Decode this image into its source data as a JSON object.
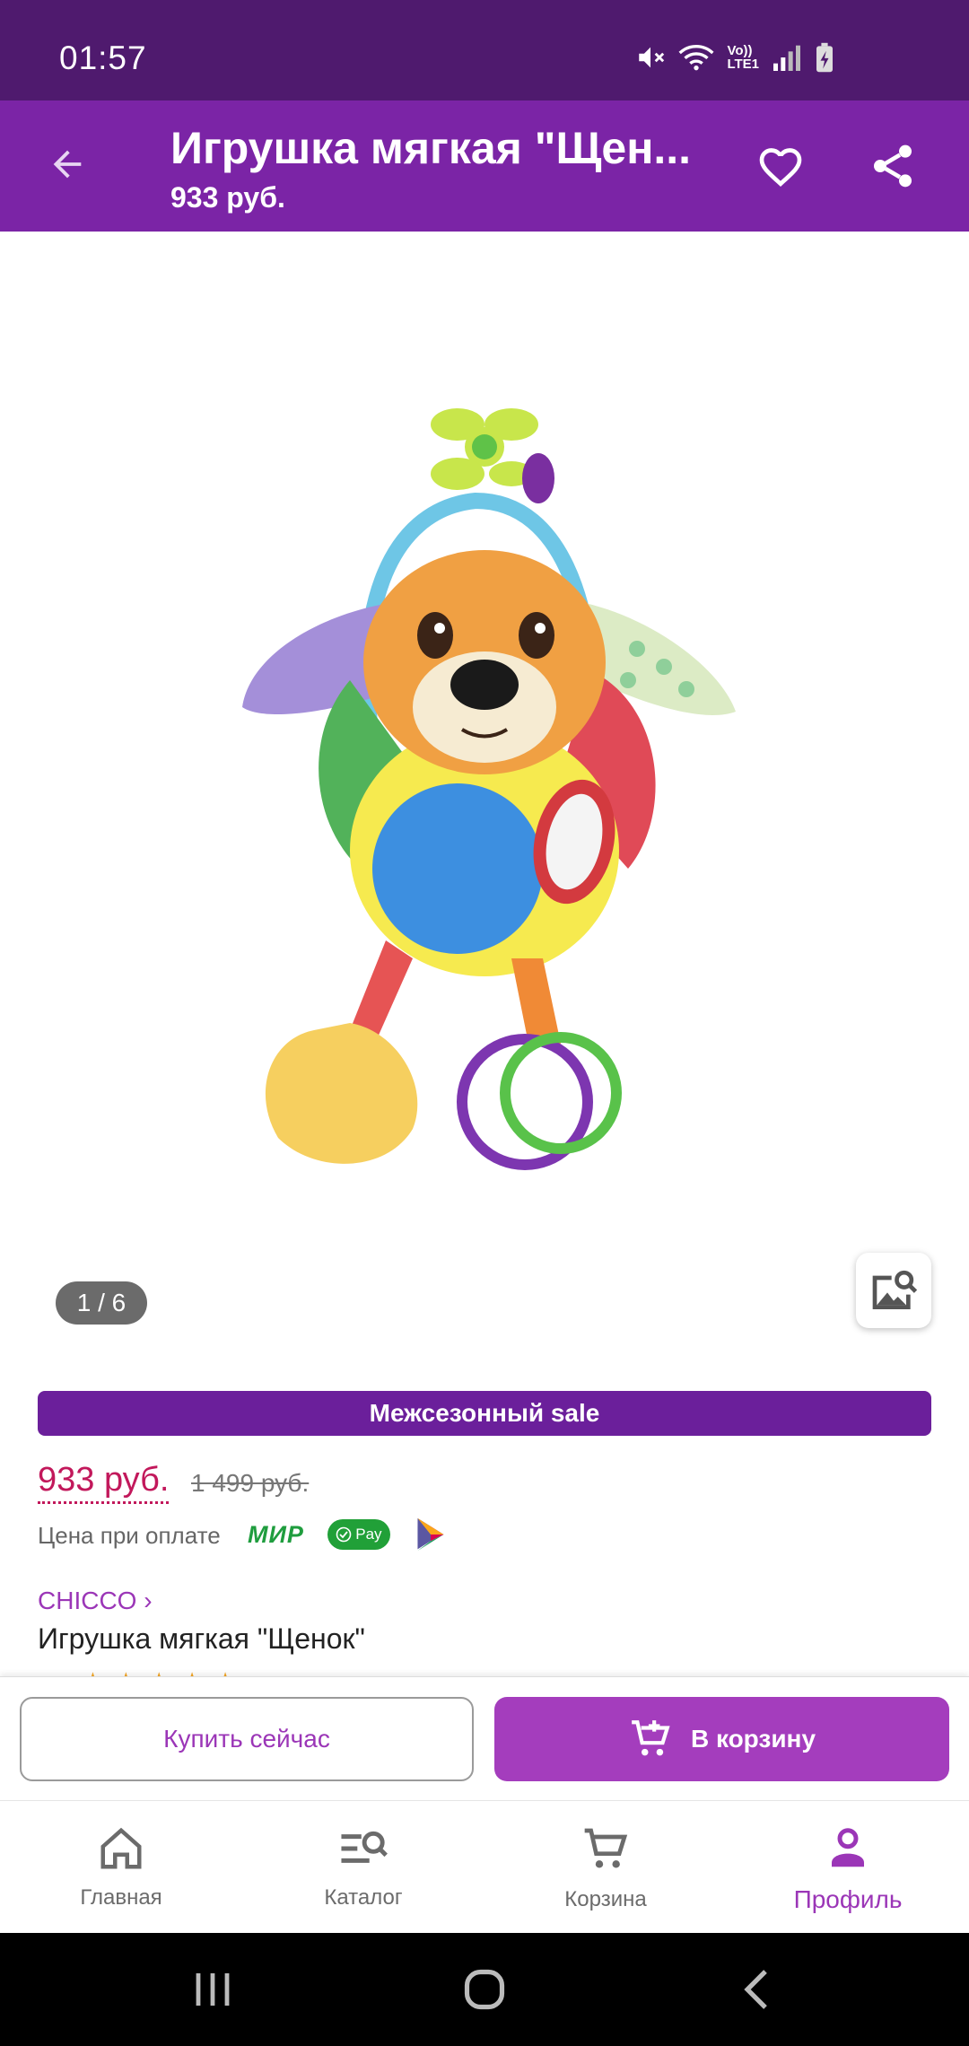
{
  "status_bar": {
    "time": "01:57",
    "icons": [
      "mute-icon",
      "wifi-icon",
      "volte-icon",
      "signal-icon",
      "battery-charging-icon"
    ],
    "volte_line1": "Vo))",
    "volte_line2": "LTE1"
  },
  "app_bar": {
    "title": "Игрушка мягкая \"Щен...",
    "subtitle": "933 руб.",
    "back_icon": "arrow-back-icon",
    "favorite_icon": "heart-outline-icon",
    "share_icon": "share-icon",
    "color": "#7b24a6"
  },
  "gallery": {
    "counter": "1 / 6",
    "photo_search_icon": "image-search-icon"
  },
  "product": {
    "sale_banner": "Межсезонный sale",
    "price": "933 руб.",
    "old_price": "1 499 руб.",
    "payment_label": "Цена при оплате",
    "payment_methods": {
      "mir": "МИР",
      "sber_pay": "Pay"
    },
    "brand": "CHICCO ›",
    "name": "Игрушка мягкая \"Щенок\"",
    "rating_stars": "★★★★★",
    "price_color": "#c2185b"
  },
  "actions": {
    "buy_now": "Купить сейчас",
    "add_to_cart": "В корзину",
    "accent_color": "#a43dbd"
  },
  "bottom_nav": {
    "items": [
      {
        "label": "Главная",
        "icon": "home-icon"
      },
      {
        "label": "Каталог",
        "icon": "catalog-search-icon"
      },
      {
        "label": "Корзина",
        "icon": "cart-icon"
      },
      {
        "label": "Профиль",
        "icon": "profile-icon",
        "active": true
      }
    ]
  },
  "system_nav": {
    "buttons": [
      "recents-icon",
      "home-circle-icon",
      "back-chevron-icon"
    ]
  }
}
